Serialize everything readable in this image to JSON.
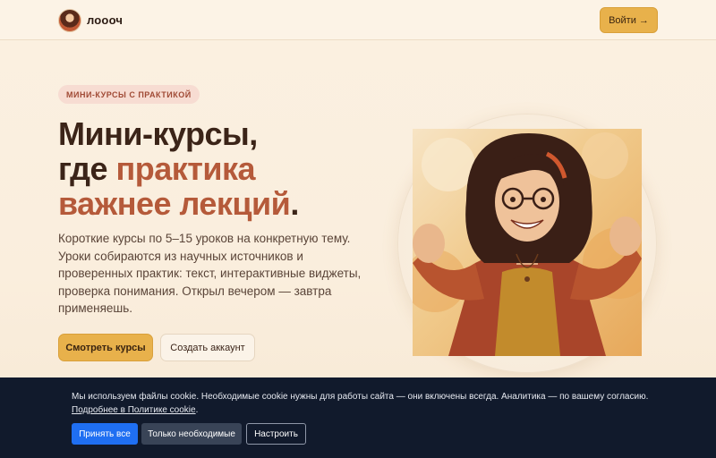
{
  "header": {
    "brand_name": "лоооч",
    "login_label": "Войти →"
  },
  "hero": {
    "badge": "МИНИ-КУРСЫ С ПРАКТИКОЙ",
    "title_part1": "Мини-курсы,",
    "title_part2_plain": "где ",
    "title_part2_accent": "практика",
    "title_part3_accent": "важнее лекций",
    "title_part3_plain": ".",
    "lead": "Короткие курсы по 5–15 уроков на конкретную тему. Уроки собираются из научных источников и проверенных практик: текст, интерактивные виджеты, проверка понимания. Открыл вечером — завтра применяешь.",
    "primary_cta": "Смотреть курсы",
    "secondary_cta": "Создать аккаунт"
  },
  "cookie": {
    "text": "Мы используем файлы cookie. Необходимые cookie нужны для работы сайта — они включены всегда. Аналитика — по вашему согласию. ",
    "link_text": "Подробнее в Политике cookie",
    "text_end": ".",
    "accept_all": "Принять все",
    "only_necessary": "Только необходимые",
    "configure": "Настроить"
  },
  "colors": {
    "accent": "#e8b14b",
    "title_accent": "#b55a3a",
    "cookie_bg": "#111a2c",
    "cookie_primary": "#1f6ff2"
  }
}
